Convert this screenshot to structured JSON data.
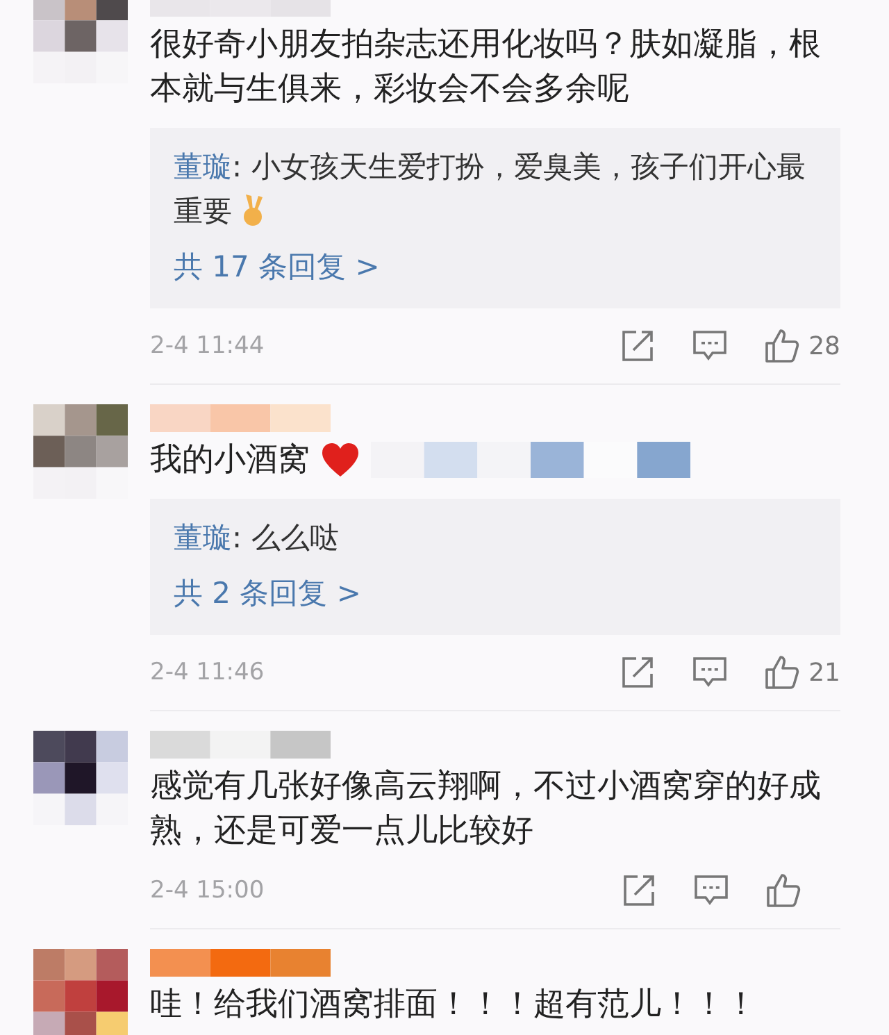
{
  "comments": [
    {
      "text": "很好奇小朋友拍杂志还用化妆吗？肤如凝脂，根本就与生俱来，彩妆会不会多余呢",
      "reply": {
        "author": "董璇",
        "text": ": 小女孩天生爱打扮，爱臭美，孩子们开心最重要",
        "emoji": {
          "kind": "victory"
        },
        "more": "共 17 条回复 >"
      },
      "time": "2-4 11:44",
      "likes": "28"
    },
    {
      "text": "我的小酒窝",
      "emoji": {
        "kind": "heart"
      },
      "reply": {
        "author": "董璇",
        "text": ": 么么哒",
        "more": "共 2 条回复 >"
      },
      "time": "2-4 11:46",
      "likes": "21"
    },
    {
      "text": "感觉有几张好像高云翔啊，不过小酒窝穿的好成熟，还是可爱一点儿比较好",
      "time": "2-4 15:00"
    },
    {
      "text": "哇！给我们酒窝排面！！！超有范儿！！！"
    }
  ]
}
